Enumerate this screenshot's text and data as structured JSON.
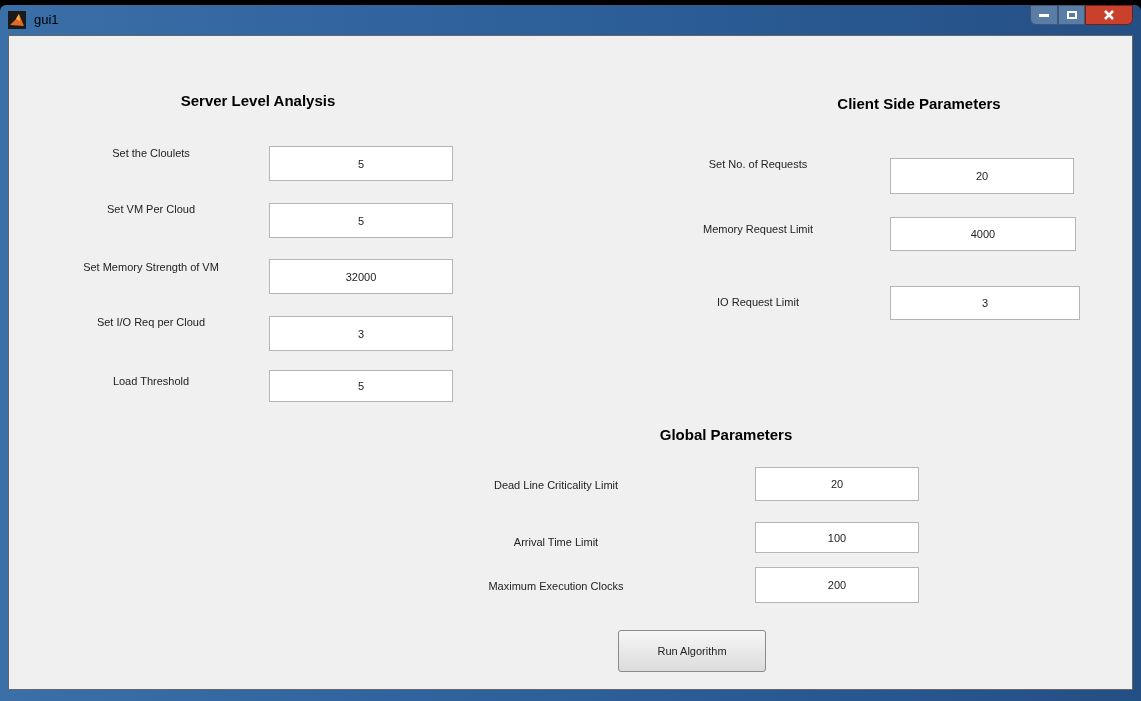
{
  "window": {
    "title": "gui1"
  },
  "sections": [
    {
      "title": "Server Level Analysis",
      "fields": [
        {
          "label": "Set the Cloulets",
          "value": "5"
        },
        {
          "label": "Set VM Per Cloud",
          "value": "5"
        },
        {
          "label": "Set Memory Strength of VM",
          "value": "32000"
        },
        {
          "label": "Set I/O Req per Cloud",
          "value": "3"
        },
        {
          "label": "Load Threshold",
          "value": "5"
        }
      ]
    },
    {
      "title": "Client Side Parameters",
      "fields": [
        {
          "label": "Set No. of Requests",
          "value": "20"
        },
        {
          "label": "Memory Request Limit",
          "value": "4000"
        },
        {
          "label": "IO Request Limit",
          "value": "3"
        }
      ]
    },
    {
      "title": "Global Parameters",
      "fields": [
        {
          "label": "Dead Line Criticality Limit",
          "value": "20"
        },
        {
          "label": "Arrival Time Limit",
          "value": "100"
        },
        {
          "label": "Maximum Execution Clocks",
          "value": "200"
        }
      ]
    }
  ],
  "button": {
    "label": "Run Algorithm"
  }
}
